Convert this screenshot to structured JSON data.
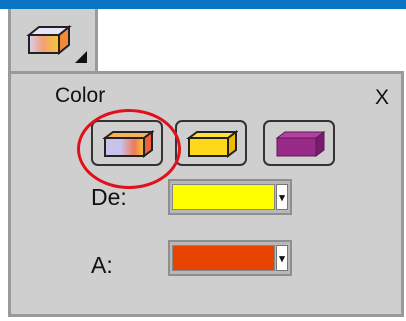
{
  "header": {
    "accent_color": "#0b74c4",
    "tab_icon": "gradient-eraser-dropdown-icon"
  },
  "panel": {
    "title": "Color",
    "close_label": "X",
    "fill_options": [
      {
        "name": "gradient-fill",
        "icon": "gradient-box-icon",
        "selected": true
      },
      {
        "name": "solid-yellow-fill",
        "icon": "yellow-box-icon",
        "selected": false
      },
      {
        "name": "solid-purple-fill",
        "icon": "purple-box-icon",
        "selected": false
      }
    ],
    "from": {
      "label": "De:",
      "color": "#ffff00",
      "arrow": "▾"
    },
    "to": {
      "label": "A:",
      "color": "#e84400",
      "arrow": "▾"
    }
  }
}
